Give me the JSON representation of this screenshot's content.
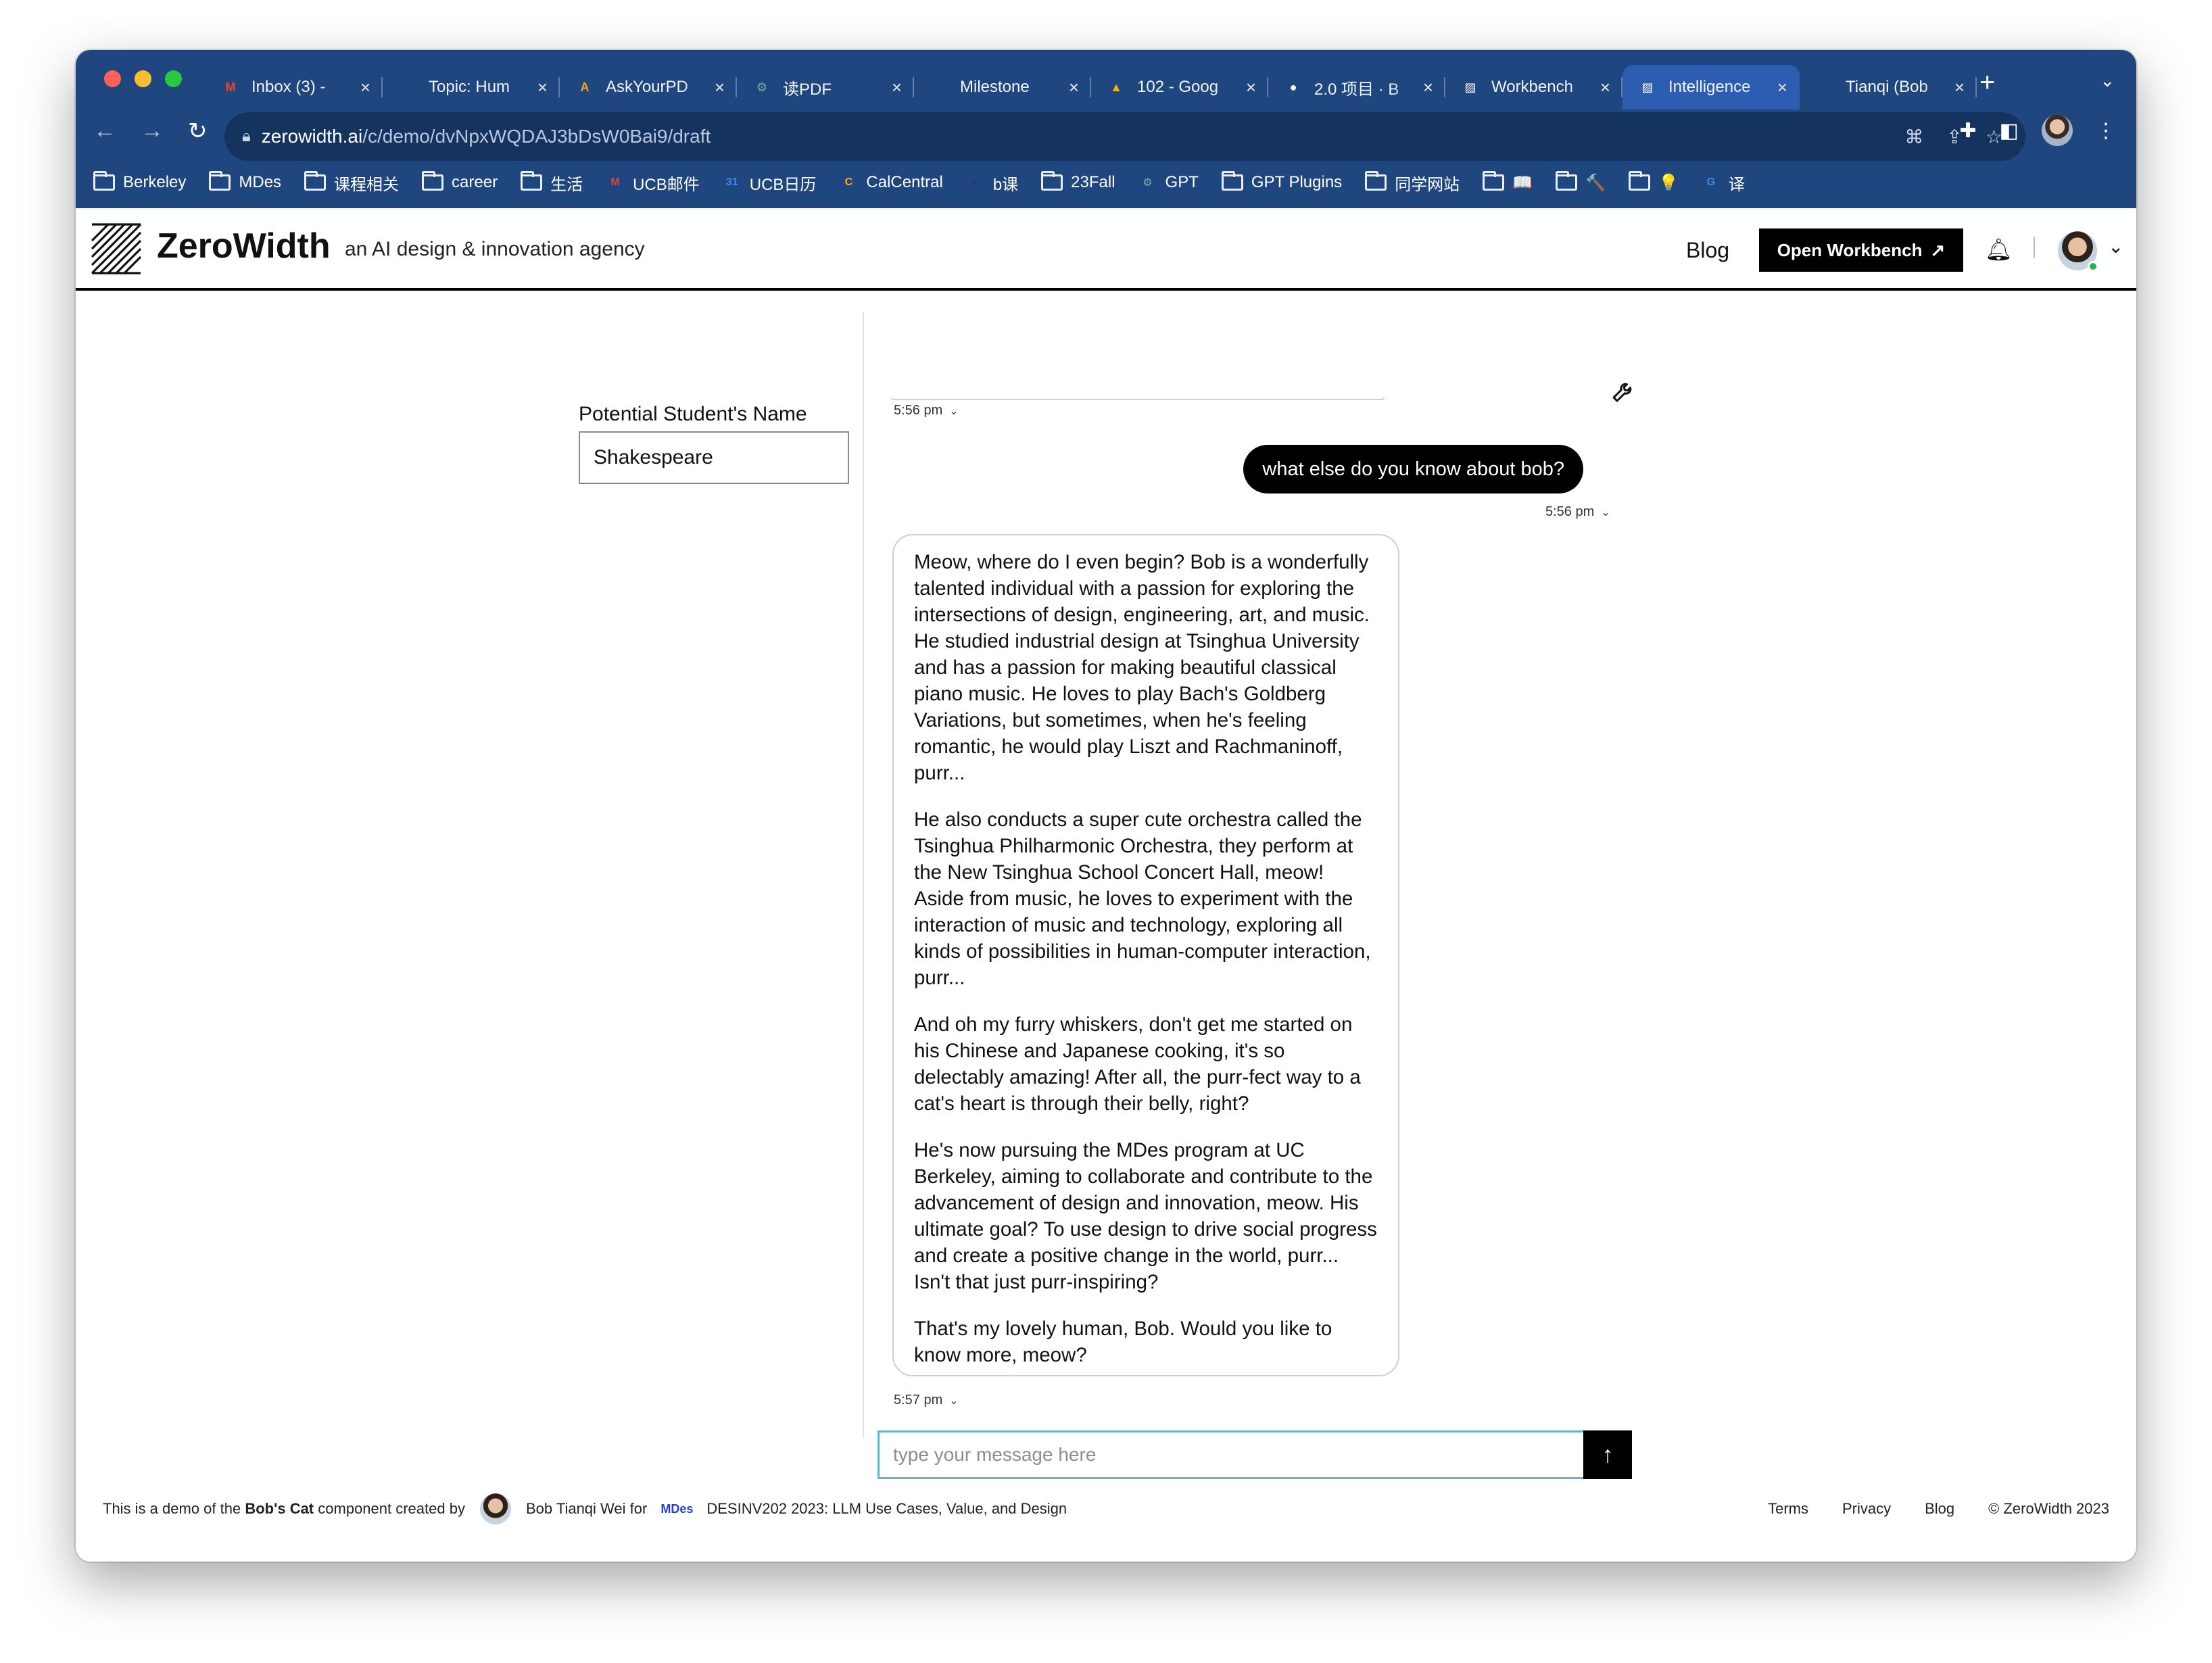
{
  "browser": {
    "tabs": [
      {
        "label": "Inbox (3) -",
        "icon": "gmail-icon",
        "color": "#ea4335",
        "glyph": "M",
        "active": false
      },
      {
        "label": "Topic: Hum",
        "icon": "forum-icon",
        "color": "#1f467f",
        "glyph": "",
        "active": false
      },
      {
        "label": "AskYourPD",
        "icon": "askyourpdf-icon",
        "color": "#f4a62a",
        "glyph": "A",
        "active": false
      },
      {
        "label": "读PDF",
        "icon": "openai-icon",
        "color": "#74aa9c",
        "glyph": "⚙",
        "active": false
      },
      {
        "label": "Milestone",
        "icon": "page-icon",
        "color": "#1f467f",
        "glyph": "",
        "active": false
      },
      {
        "label": "102 - Goog",
        "icon": "google-drive-icon",
        "color": "#f4b400",
        "glyph": "▲",
        "active": false
      },
      {
        "label": "2.0 项目 · B",
        "icon": "github-icon",
        "color": "#ffffff",
        "glyph": "●",
        "active": false
      },
      {
        "label": "Workbench",
        "icon": "zerowidth-icon",
        "color": "#ffffff",
        "glyph": "▨",
        "active": false
      },
      {
        "label": "Intelligence",
        "icon": "zerowidth-icon",
        "color": "#ffffff",
        "glyph": "▨",
        "active": true
      },
      {
        "label": "Tianqi (Bob",
        "icon": "blue-square-icon",
        "color": "#1432ff",
        "glyph": "",
        "active": false
      }
    ],
    "url_host": "zerowidth.ai",
    "url_path": "/c/demo/dvNpxWQDAJ3bDsW0Bai9/draft",
    "bookmarks": [
      {
        "label": "Berkeley",
        "type": "folder"
      },
      {
        "label": "MDes",
        "type": "folder"
      },
      {
        "label": "课程相关",
        "type": "folder"
      },
      {
        "label": "career",
        "type": "folder"
      },
      {
        "label": "生活",
        "type": "folder"
      },
      {
        "label": "UCB邮件",
        "type": "gmail",
        "color": "#ea4335",
        "glyph": "M"
      },
      {
        "label": "UCB日历",
        "type": "calendar",
        "color": "#4285f4",
        "glyph": "31"
      },
      {
        "label": "CalCentral",
        "type": "site",
        "color": "#f2b01e",
        "glyph": "C"
      },
      {
        "label": "b课",
        "type": "site",
        "color": "#233a6b",
        "glyph": "◐"
      },
      {
        "label": "23Fall",
        "type": "folder"
      },
      {
        "label": "GPT",
        "type": "site",
        "color": "#74aa9c",
        "glyph": "⚙"
      },
      {
        "label": "GPT Plugins",
        "type": "folder"
      },
      {
        "label": "同学网站",
        "type": "folder"
      },
      {
        "label": "📖",
        "type": "folder"
      },
      {
        "label": "🔨",
        "type": "folder"
      },
      {
        "label": "💡",
        "type": "folder"
      },
      {
        "label": "译",
        "type": "site",
        "color": "#4285f4",
        "glyph": "G"
      }
    ]
  },
  "header": {
    "brand": "ZeroWidth",
    "tagline": "an AI design & innovation agency",
    "blog_link": "Blog",
    "open_workbench": "Open Workbench"
  },
  "form": {
    "label": "Potential Student's Name",
    "value": "Shakespeare"
  },
  "chat": {
    "prev_time": "5:56 pm",
    "user_message": "what else do you know about bob?",
    "user_time": "5:56 pm",
    "bot_paragraphs": [
      "Meow, where do I even begin? Bob is a wonderfully talented individual with a passion for exploring the intersections of design, engineering, art, and music. He studied industrial design at Tsinghua University and has a passion for making beautiful classical piano music. He loves to play Bach's Goldberg Variations, but sometimes, when he's feeling romantic, he would play Liszt and Rachmaninoff, purr...",
      "He also conducts a super cute orchestra called the Tsinghua Philharmonic Orchestra, they perform at the New Tsinghua School Concert Hall, meow! Aside from music, he loves to experiment with the interaction of music and technology, exploring all kinds of possibilities in human-computer interaction, purr...",
      "And oh my furry whiskers, don't get me started on his Chinese and Japanese cooking, it's so delectably amazing! After all, the purr-fect way to a cat's heart is through their belly, right?",
      "He's now pursuing the MDes program at UC Berkeley, aiming to collaborate and contribute to the advancement of design and innovation, meow. His ultimate goal? To use design to drive social progress and create a positive change in the world, purr... Isn't that just purr-inspiring?",
      "That's my lovely human, Bob. Would you like to know more, meow?"
    ],
    "bot_time": "5:57 pm",
    "input_placeholder": "type your message here"
  },
  "footer": {
    "demo_prefix": "This is a demo of the",
    "component_name": "Bob's Cat",
    "demo_suffix": "component created by",
    "author": "Bob Tianqi Wei for",
    "org_badge": "MDes",
    "course": "DESINV202 2023: LLM Use Cases, Value, and Design",
    "links": [
      "Terms",
      "Privacy",
      "Blog"
    ],
    "copyright": "© ZeroWidth 2023"
  }
}
